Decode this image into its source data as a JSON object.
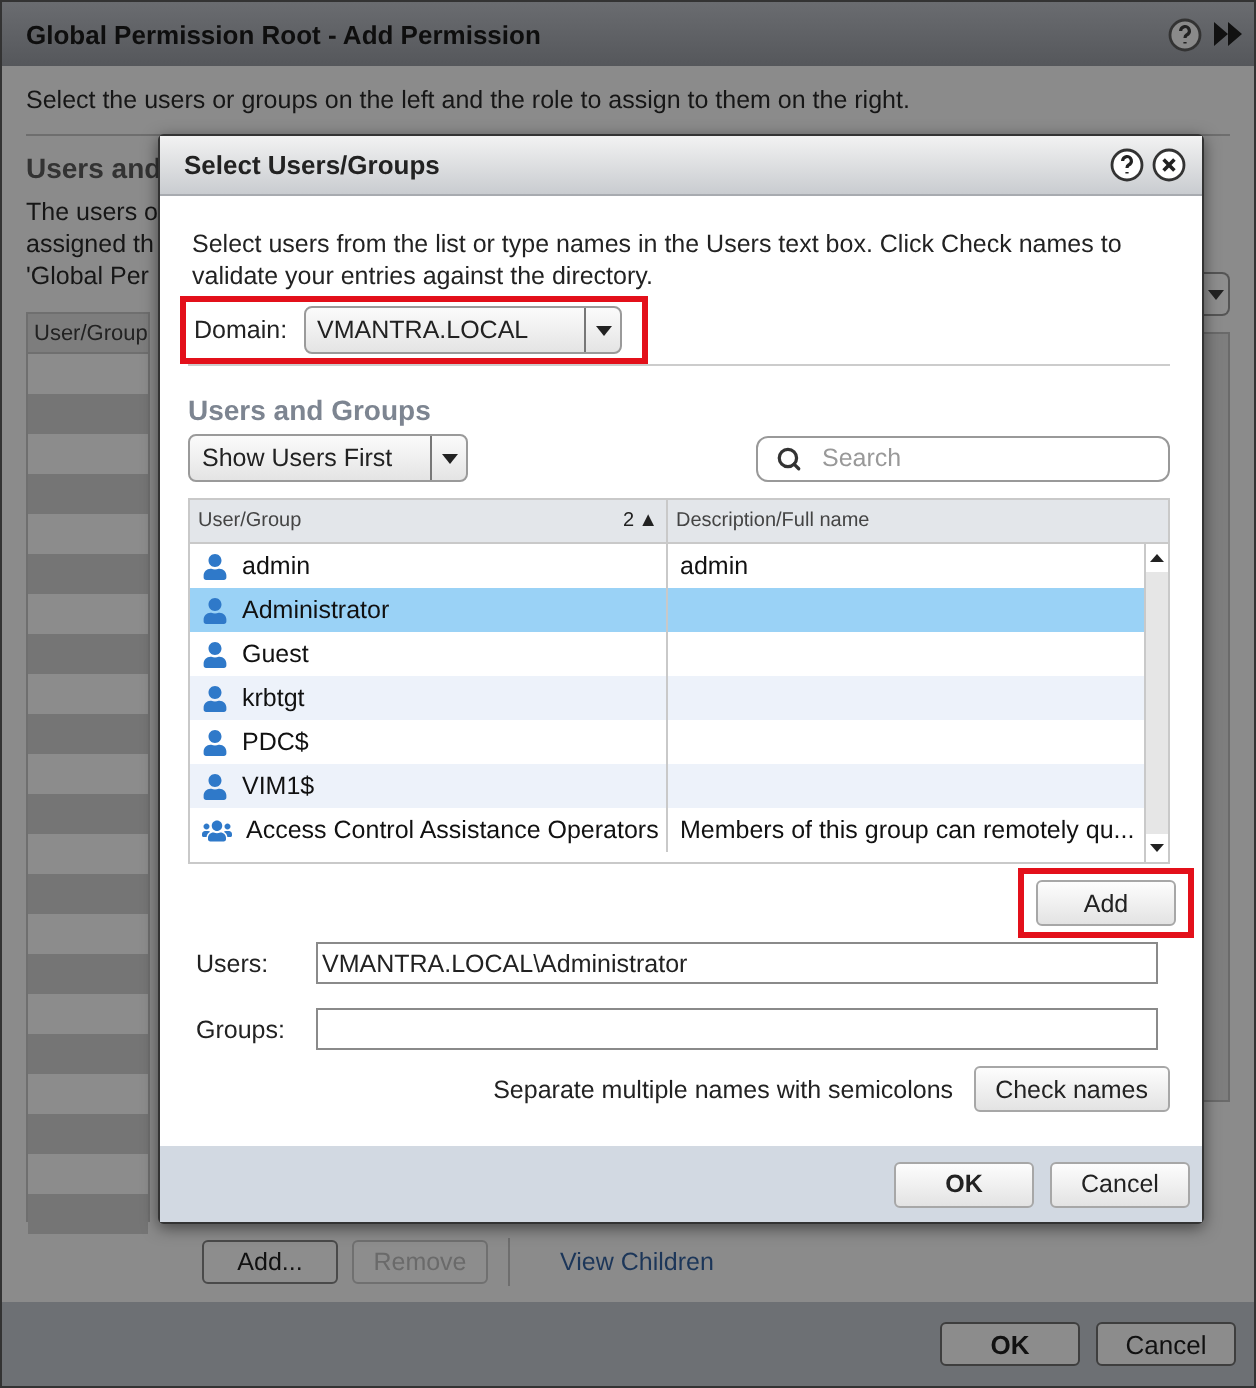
{
  "window": {
    "title": "Global Permission Root - Add Permission"
  },
  "background": {
    "instructions": "Select the users or groups on the left and the role to assign to them on the right.",
    "section_heading": "Users and",
    "description_lines": [
      "The users o",
      "assigned th",
      "'Global Per"
    ],
    "table": {
      "columns": [
        "User/Group"
      ]
    },
    "buttons": [
      {
        "label": "Add...",
        "disabled": false
      },
      {
        "label": "Remove",
        "disabled": true
      }
    ],
    "link": "View Children",
    "footer_buttons": [
      {
        "label": "OK",
        "primary": true
      },
      {
        "label": "Cancel",
        "primary": false
      }
    ]
  },
  "dialog": {
    "title": "Select Users/Groups",
    "instructions": "Select users from the list or type names in the Users text box. Click Check names to validate your entries against the directory.",
    "domain": {
      "label": "Domain:",
      "value": "VMANTRA.LOCAL"
    },
    "section_heading": "Users and Groups",
    "sort_dropdown": "Show Users First",
    "search": {
      "placeholder": "Search"
    },
    "table": {
      "columns": [
        {
          "label": "User/Group",
          "sort_index": "2",
          "sort_arrow": "▲"
        },
        {
          "label": "Description/Full name"
        }
      ],
      "rows": [
        {
          "kind": "user",
          "name": "admin",
          "description": "admin",
          "selected": false
        },
        {
          "kind": "user",
          "name": "Administrator",
          "selected": true
        },
        {
          "kind": "user",
          "name": "Guest",
          "selected": false
        },
        {
          "kind": "user",
          "name": "krbtgt",
          "selected": false
        },
        {
          "kind": "user",
          "name": "PDC$",
          "selected": false
        },
        {
          "kind": "user",
          "name": "VIM1$",
          "selected": false
        },
        {
          "kind": "group",
          "name": "Access Control Assistance Operators",
          "description": "Members of this group can remotely qu...",
          "selected": false
        }
      ]
    },
    "add_button": "Add",
    "users": {
      "label": "Users:",
      "value": "VMANTRA.LOCAL\\Administrator"
    },
    "groups": {
      "label": "Groups:"
    },
    "hint": "Separate multiple names with semicolons",
    "check_button": "Check names",
    "footer_buttons": [
      {
        "label": "OK",
        "primary": true
      },
      {
        "label": "Cancel",
        "primary": false
      }
    ]
  }
}
